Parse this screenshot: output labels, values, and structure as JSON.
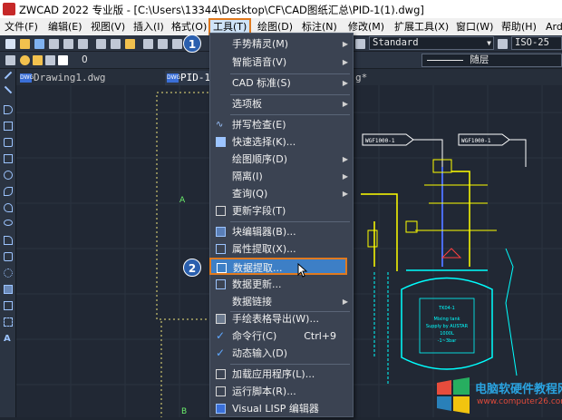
{
  "window": {
    "title": "ZWCAD 2022 专业版 - [C:\\Users\\13344\\Desktop\\CF\\CAD图纸汇总\\PID-1(1).dwg]"
  },
  "menubar": {
    "items": [
      {
        "label": "文件(F)"
      },
      {
        "label": "编辑(E)"
      },
      {
        "label": "视图(V)"
      },
      {
        "label": "插入(I)"
      },
      {
        "label": "格式(O)"
      },
      {
        "label": "工具(T)"
      },
      {
        "label": "绘图(D)"
      },
      {
        "label": "标注(N)"
      },
      {
        "label": "修改(M)"
      },
      {
        "label": "扩展工具(X)"
      },
      {
        "label": "窗口(W)"
      },
      {
        "label": "帮助(H)"
      },
      {
        "label": "Ard"
      }
    ]
  },
  "toolbar": {
    "text_style": "Standard",
    "dim_style": "ISO-25",
    "layer": "0",
    "linetype": "随层"
  },
  "tabs": [
    {
      "label": "Drawing1.dwg"
    },
    {
      "label": "PID-1"
    },
    {
      "label": "g*"
    }
  ],
  "tools_menu": {
    "items": [
      {
        "label": "手势精灵(M)",
        "submenu": true,
        "icon": "blank"
      },
      {
        "label": "智能语音(V)",
        "submenu": true,
        "icon": "blank"
      },
      {
        "label": "CAD 标准(S)",
        "submenu": true,
        "icon": "blank"
      },
      {
        "label": "选项板",
        "submenu": true,
        "icon": "blank"
      },
      {
        "label": "拼写检查(E)",
        "icon": "spell-check-icon"
      },
      {
        "label": "快速选择(K)...",
        "icon": "quick-select-icon"
      },
      {
        "label": "绘图顺序(D)",
        "submenu": true,
        "icon": "blank"
      },
      {
        "label": "隔离(I)",
        "submenu": true,
        "icon": "blank"
      },
      {
        "label": "查询(Q)",
        "submenu": true,
        "icon": "blank"
      },
      {
        "label": "更新字段(T)",
        "icon": "update-field-icon"
      },
      {
        "label": "块编辑器(B)...",
        "icon": "block-editor-icon"
      },
      {
        "label": "属性提取(X)...",
        "icon": "attribute-extract-icon"
      },
      {
        "label": "数据提取...",
        "icon": "data-extract-icon"
      },
      {
        "label": "数据更新...",
        "icon": "data-update-icon"
      },
      {
        "label": "数据链接",
        "submenu": true,
        "icon": "blank"
      },
      {
        "label": "手绘表格导出(W)...",
        "icon": "table-export-icon"
      },
      {
        "label": "命令行(C)",
        "shortcut": "Ctrl+9",
        "icon": "check-icon"
      },
      {
        "label": "动态输入(D)",
        "icon": "check-icon"
      },
      {
        "label": "加载应用程序(L)...",
        "icon": "load-app-icon"
      },
      {
        "label": "运行脚本(R)...",
        "icon": "run-script-icon"
      },
      {
        "label": "Visual LISP 编辑器",
        "icon": "lisp-editor-icon"
      }
    ]
  },
  "badges": {
    "one": "1",
    "two": "2"
  },
  "drawing": {
    "label_a": "A",
    "label_b": "B",
    "tag1": "WGF1000-1",
    "tag2": "WGF1000-1",
    "tank_text": [
      "TK04-1",
      "Mixing tank",
      "Supply by AUSTAR",
      "1000L",
      "-1~3bar"
    ]
  },
  "watermark": {
    "title": "电脑软硬件教程网",
    "url": "www.computer26.com"
  },
  "colors": {
    "accent": "#e07a1f",
    "highlight": "#3d7fc6",
    "badge": "#2a5fae",
    "drawing_yellow": "#ffff00",
    "drawing_cyan": "#00ffff"
  }
}
